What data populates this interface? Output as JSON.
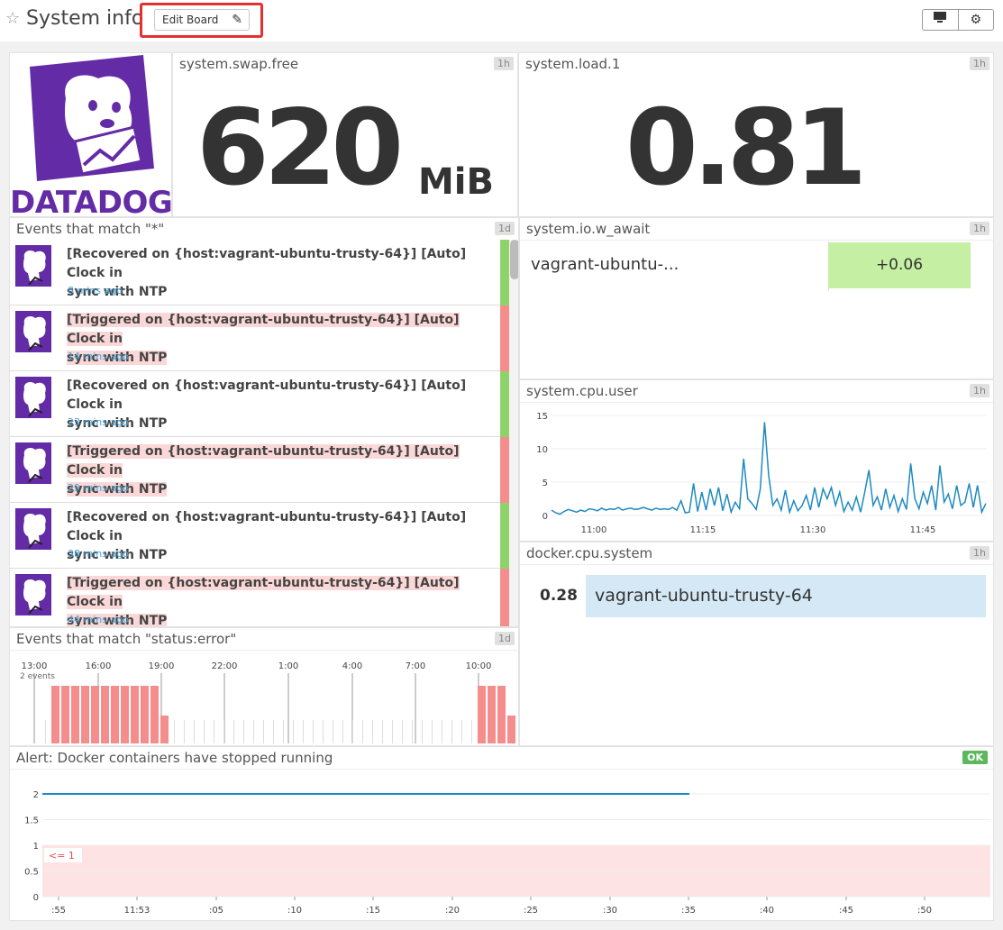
{
  "header": {
    "title": "System info",
    "edit_label": "Edit Board"
  },
  "logo": {
    "text": "DATADOG"
  },
  "swap": {
    "title": "system.swap.free",
    "range": "1h",
    "value": "620",
    "unit": "MiB"
  },
  "load": {
    "title": "system.load.1",
    "range": "1h",
    "value": "0.81"
  },
  "events": {
    "title": "Events that match \"*\"",
    "range": "1d",
    "items": [
      {
        "prefix": "[Recovered on {host:vagrant-ubuntu-trusty-64}] [Auto] Clock in",
        "suffix": "sync with NTP",
        "time": "8 mins ago",
        "status": "recovered"
      },
      {
        "prefix": "[Triggered on {host:vagrant-ubuntu-trusty-64}] [Auto] Clock in",
        "suffix": "sync with NTP",
        "time": "14 mins ago",
        "status": "triggered"
      },
      {
        "prefix": "[Recovered on {host:vagrant-ubuntu-trusty-64}] [Auto] Clock in",
        "suffix": "sync with NTP",
        "time": "23 mins ago",
        "status": "recovered"
      },
      {
        "prefix": "[Triggered on {host:vagrant-ubuntu-trusty-64}] [Auto] Clock in",
        "suffix": "sync with NTP",
        "time": "29 mins ago",
        "status": "triggered"
      },
      {
        "prefix": "[Recovered on {host:vagrant-ubuntu-trusty-64}] [Auto] Clock in",
        "suffix": "sync with NTP",
        "time": "38 mins ago",
        "status": "recovered"
      },
      {
        "prefix": "[Triggered on {host:vagrant-ubuntu-trusty-64}] [Auto] Clock in",
        "suffix": "sync with NTP",
        "time": "44 mins ago",
        "status": "triggered"
      }
    ]
  },
  "io": {
    "title": "system.io.w_await",
    "range": "1h",
    "host": "vagrant-ubuntu-...",
    "value": "+0.06"
  },
  "cpu_user": {
    "title": "system.cpu.user",
    "range": "1h"
  },
  "docker": {
    "title": "docker.cpu.system",
    "range": "1h",
    "value": "0.28",
    "host": "vagrant-ubuntu-trusty-64"
  },
  "err_events": {
    "title": "Events that match \"status:error\"",
    "range": "1d",
    "annotation": "2 events"
  },
  "alert": {
    "title": "Alert: Docker containers have stopped running",
    "status": "OK",
    "threshold": "<= 1"
  },
  "colors": {
    "brand": "#632ca6",
    "recovered": "#8fd16a",
    "triggered": "#f58d8d",
    "line": "#1f8ac0"
  },
  "chart_data": [
    {
      "type": "line",
      "title": "system.cpu.user",
      "x_ticks": [
        "11:00",
        "11:15",
        "11:30",
        "11:45"
      ],
      "y_ticks": [
        "0",
        "5",
        "10",
        "15"
      ],
      "ylim": [
        0,
        15
      ],
      "series": [
        {
          "values": [
            0.8,
            0.4,
            0.2,
            0.6,
            0.9,
            0.7,
            0.5,
            0.8,
            0.6,
            1.0,
            0.9,
            0.7,
            1.1,
            0.8,
            1.0,
            0.9,
            1.2,
            0.8,
            1.0,
            1.1,
            0.9,
            1.0,
            1.2,
            1.0,
            0.8,
            1.1,
            0.9,
            1.0,
            0.9,
            1.2,
            0.8,
            2.2,
            0.4,
            0.5,
            4.8,
            0.6,
            3.5,
            0.8,
            4.0,
            1.5,
            4.2,
            0.7,
            3.2,
            0.5,
            2.0,
            1.0,
            8.5,
            2.5,
            1.8,
            0.9,
            4.0,
            14.0,
            6.0,
            1.5,
            2.5,
            0.8,
            3.8,
            0.5,
            2.2,
            0.7,
            1.5,
            3.0,
            0.8,
            4.2,
            1.2,
            4.0,
            2.5,
            4.2,
            1.5,
            3.5,
            0.6,
            2.0,
            0.8,
            2.8,
            0.5,
            3.5,
            6.8,
            1.5,
            2.8,
            0.8,
            4.0,
            1.2,
            3.0,
            0.6,
            2.5,
            0.9,
            7.8,
            2.5,
            1.0,
            3.5,
            1.8,
            4.5,
            0.8,
            7.5,
            2.0,
            3.2,
            1.0,
            4.5,
            1.5,
            2.0,
            4.8,
            1.2,
            4.5,
            0.5,
            1.8
          ]
        }
      ]
    },
    {
      "type": "bar",
      "title": "Events that match \"status:error\"",
      "x_ticks": [
        "13:00",
        "16:00",
        "19:00",
        "22:00",
        "1:00",
        "4:00",
        "7:00",
        "10:00"
      ],
      "values": [
        0,
        2,
        2,
        2,
        2,
        2,
        2,
        2,
        2,
        2,
        2,
        2,
        1,
        0,
        0,
        0,
        0,
        0,
        0,
        0,
        0,
        0,
        0,
        0,
        0,
        0,
        0,
        0,
        0,
        0,
        0,
        0,
        0,
        0,
        0,
        0,
        0,
        0,
        0,
        0,
        0,
        0,
        0,
        0,
        2,
        2,
        2,
        1
      ]
    },
    {
      "type": "line",
      "title": "Alert: Docker containers have stopped running",
      "x_ticks": [
        ":55",
        "11:53",
        ":05",
        ":10",
        ":15",
        ":20",
        ":25",
        ":30",
        ":35",
        ":40",
        ":45",
        ":50"
      ],
      "y_ticks": [
        "0",
        "0.5",
        "1",
        "1.5",
        "2"
      ],
      "ylim": [
        0,
        2
      ],
      "series": [
        {
          "values": [
            2,
            2
          ]
        }
      ],
      "threshold": 1
    }
  ]
}
